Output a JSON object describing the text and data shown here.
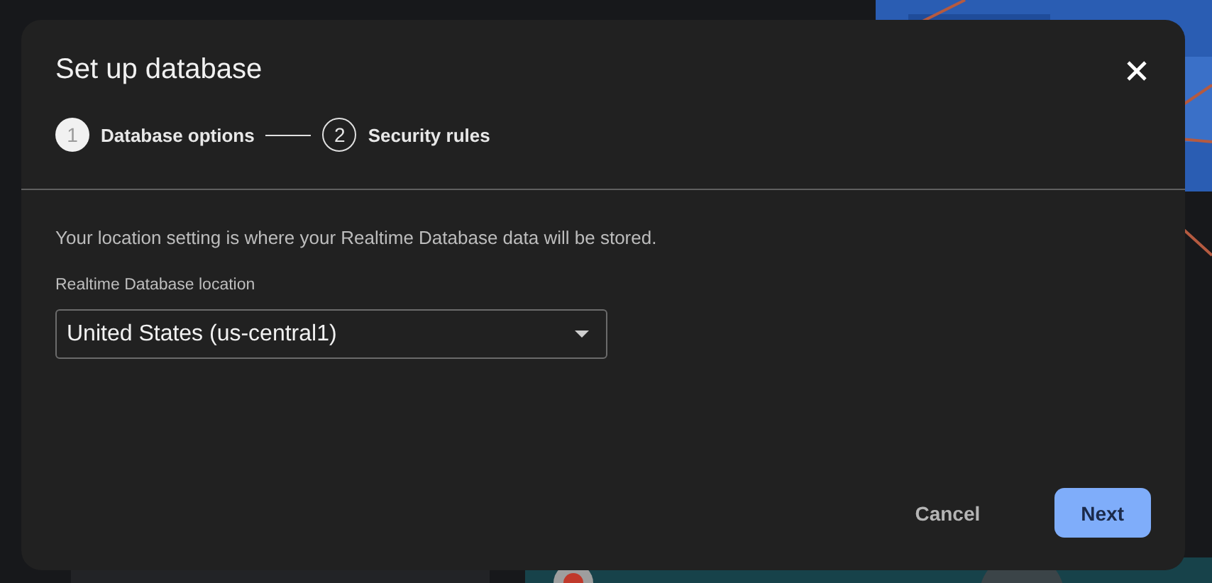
{
  "dialog": {
    "title": "Set up database",
    "steps": [
      {
        "number": "1",
        "label": "Database options",
        "selected": true
      },
      {
        "number": "2",
        "label": "Security rules",
        "selected": false
      }
    ],
    "description": "Your location setting is where your Realtime Database data will be stored.",
    "location_field": {
      "label": "Realtime Database location",
      "value": "United States (us-central1)"
    },
    "buttons": [
      {
        "label": "Cancel",
        "kind": "text"
      },
      {
        "label": "Next",
        "kind": "primary"
      }
    ]
  }
}
